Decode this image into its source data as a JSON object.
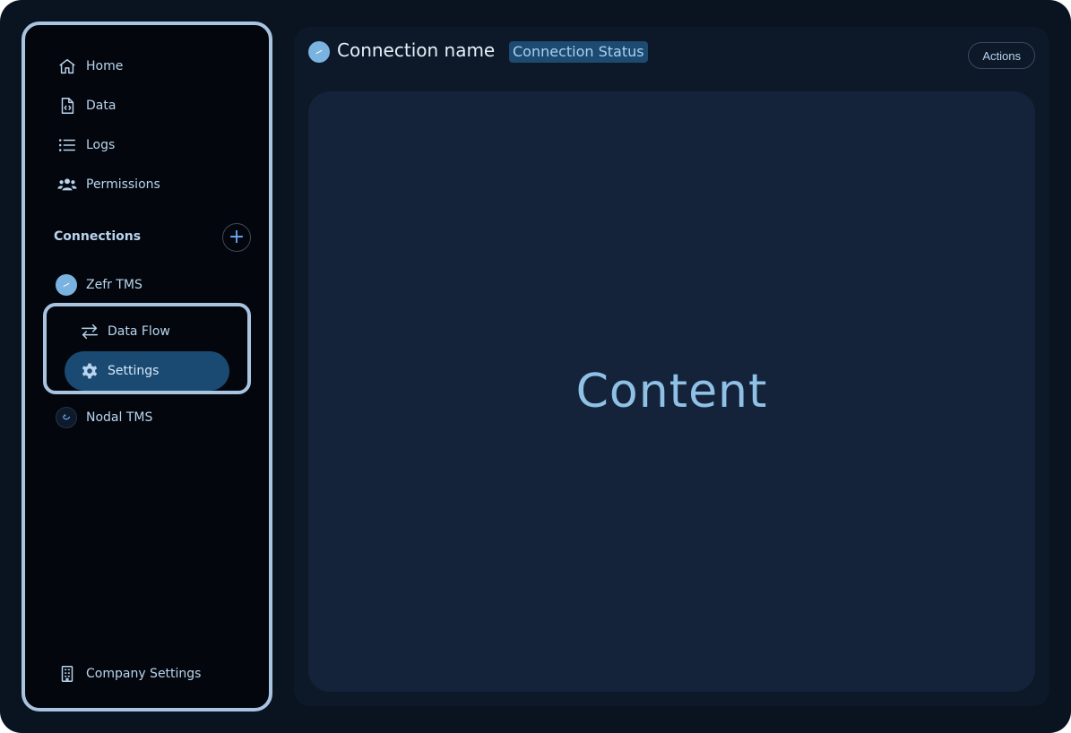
{
  "sidebar": {
    "nav": [
      {
        "label": "Home",
        "icon": "home-icon"
      },
      {
        "label": "Data",
        "icon": "file-code-icon"
      },
      {
        "label": "Logs",
        "icon": "list-icon"
      },
      {
        "label": "Permissions",
        "icon": "users-icon"
      }
    ],
    "connections_label": "Connections",
    "add_label": "+",
    "connections": [
      {
        "label": "Zefr TMS",
        "icon": "zefr-avatar"
      },
      {
        "label": "Nodal TMS",
        "icon": "nodal-avatar"
      }
    ],
    "sub_items": [
      {
        "label": "Data Flow",
        "icon": "arrows-swap-icon"
      },
      {
        "label": "Settings",
        "icon": "gear-icon",
        "active": true
      }
    ],
    "footer": {
      "label": "Company Settings",
      "icon": "building-icon"
    }
  },
  "header": {
    "title": "Connection name",
    "status": "Connection Status",
    "actions_label": "Actions"
  },
  "main": {
    "content_label": "Content"
  },
  "colors": {
    "background": "#0a1320",
    "sidebar": "#03070d",
    "accent": "#a8c4e0",
    "active_item": "#1a4a72",
    "panel": "#15233a",
    "text": "#b9d4ee"
  }
}
